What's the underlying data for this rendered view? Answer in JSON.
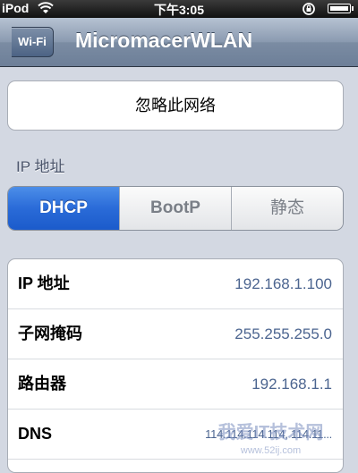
{
  "status_bar": {
    "carrier": "iPod",
    "time": "下午3:05"
  },
  "nav": {
    "back_label": "Wi-Fi",
    "title": "MicromacerWLAN"
  },
  "forget_button": "忽略此网络",
  "section_header": "IP 地址",
  "segments": [
    {
      "label": "DHCP",
      "active": true
    },
    {
      "label": "BootP",
      "active": false
    },
    {
      "label": "静态",
      "active": false
    }
  ],
  "rows": [
    {
      "label": "IP 地址",
      "value": "192.168.1.100"
    },
    {
      "label": "子网掩码",
      "value": "255.255.255.0"
    },
    {
      "label": "路由器",
      "value": "192.168.1.1"
    },
    {
      "label": "DNS",
      "value": "114.114.114.114, 114.11..."
    }
  ],
  "watermark": {
    "text": "我爱IT技术网",
    "url": "www.52ij.com"
  },
  "colors": {
    "accent": "#2a6bd8",
    "value_text": "#4c6590",
    "background": "#d3d8e2"
  }
}
